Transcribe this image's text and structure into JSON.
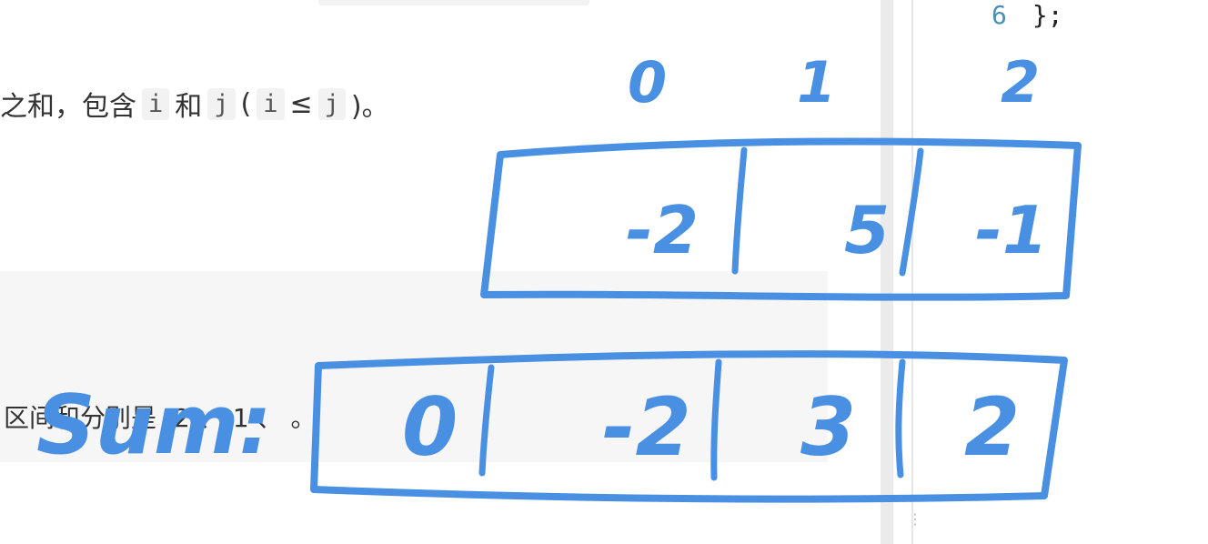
{
  "problem": {
    "desc_segments": {
      "s1": "之和，包含",
      "c1": "i",
      "s2": "和",
      "c2": "j",
      "s3": "(",
      "c3": "i",
      "s4": "≤",
      "c4": "j",
      "s5": ")。"
    },
    "example_text": "区间和分别是 -2 、-1 、 。"
  },
  "code_panel": {
    "line_number": "6",
    "code": "};"
  },
  "annotations": {
    "indices": [
      "0",
      "1",
      "2"
    ],
    "array": [
      "-2",
      "5",
      "-1"
    ],
    "sum_label": "Sum:",
    "sum": [
      "0",
      "-2",
      "3",
      "2"
    ],
    "ink_color": "#4a90e2"
  }
}
